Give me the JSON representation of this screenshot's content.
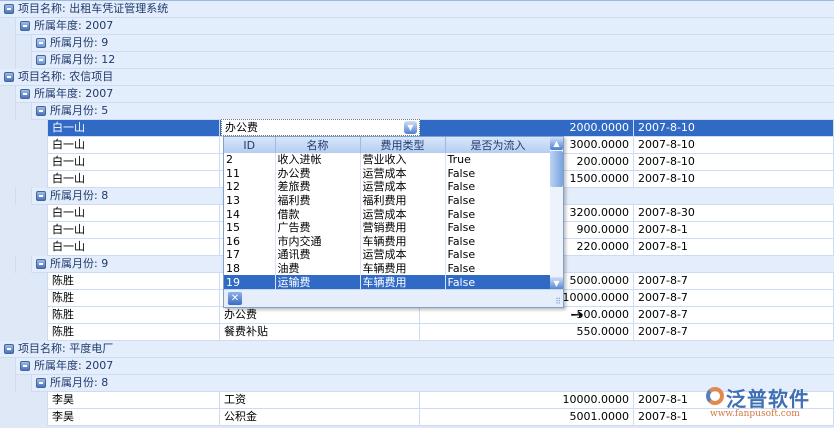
{
  "rows": [
    {
      "type": "group",
      "level": 0,
      "text": "项目名称: 出租车凭证管理系统"
    },
    {
      "type": "group",
      "level": 1,
      "text": "所属年度: 2007"
    },
    {
      "type": "group",
      "level": 2,
      "text": "所属月份: 9",
      "collapsed": true
    },
    {
      "type": "group",
      "level": 2,
      "text": "所属月份: 12",
      "collapsed": true
    },
    {
      "type": "group",
      "level": 0,
      "text": "项目名称: 农信项目"
    },
    {
      "type": "group",
      "level": 1,
      "text": "所属年度: 2007"
    },
    {
      "type": "group",
      "level": 2,
      "text": "所属月份: 5"
    },
    {
      "type": "data",
      "selected": true,
      "cells": [
        "白一山",
        "",
        "2000.0000",
        "2007-8-10"
      ]
    },
    {
      "type": "data",
      "cells": [
        "白一山",
        "",
        "3000.0000",
        "2007-8-10"
      ]
    },
    {
      "type": "data",
      "cells": [
        "白一山",
        "",
        "200.0000",
        "2007-8-10"
      ]
    },
    {
      "type": "data",
      "cells": [
        "白一山",
        "",
        "1500.0000",
        "2007-8-10"
      ]
    },
    {
      "type": "group",
      "level": 2,
      "text": "所属月份: 8"
    },
    {
      "type": "data",
      "cells": [
        "白一山",
        "",
        "3200.0000",
        "2007-8-30"
      ]
    },
    {
      "type": "data",
      "cells": [
        "白一山",
        "",
        "900.0000",
        "2007-8-1"
      ]
    },
    {
      "type": "data",
      "cells": [
        "白一山",
        "",
        "220.0000",
        "2007-8-1"
      ]
    },
    {
      "type": "group",
      "level": 2,
      "text": "所属月份: 9"
    },
    {
      "type": "data",
      "cells": [
        "陈胜",
        "",
        "5000.0000",
        "2007-8-7"
      ]
    },
    {
      "type": "data",
      "cells": [
        "陈胜",
        "",
        "10000.0000",
        "2007-8-7"
      ]
    },
    {
      "type": "data",
      "cells": [
        "陈胜",
        "办公费",
        "500.0000",
        "2007-8-7"
      ]
    },
    {
      "type": "data",
      "cells": [
        "陈胜",
        "餐费补贴",
        "550.0000",
        "2007-8-7"
      ]
    },
    {
      "type": "group",
      "level": 0,
      "text": "项目名称: 平度电厂"
    },
    {
      "type": "group",
      "level": 1,
      "text": "所属年度: 2007"
    },
    {
      "type": "group",
      "level": 2,
      "text": "所属月份: 8"
    },
    {
      "type": "data",
      "cells": [
        "李昊",
        "工资",
        "10000.0000",
        "2007-8-1"
      ]
    },
    {
      "type": "data",
      "cells": [
        "李昊",
        "公积金",
        "5001.0000",
        "2007-8-1"
      ]
    }
  ],
  "combo": {
    "value": "办公费"
  },
  "popup": {
    "headers": [
      "ID",
      "名称",
      "费用类型",
      "是否为流入"
    ],
    "rows": [
      [
        "2",
        "收入进帐",
        "营业收入",
        "True"
      ],
      [
        "11",
        "办公费",
        "运营成本",
        "False"
      ],
      [
        "12",
        "差旅费",
        "运营成本",
        "False"
      ],
      [
        "13",
        "福利费",
        "福利费用",
        "False"
      ],
      [
        "14",
        "借款",
        "运营成本",
        "False"
      ],
      [
        "15",
        "广告费",
        "营销费用",
        "False"
      ],
      [
        "16",
        "市内交通",
        "车辆费用",
        "False"
      ],
      [
        "17",
        "通讯费",
        "运营成本",
        "False"
      ],
      [
        "18",
        "油费",
        "车辆费用",
        "False"
      ],
      [
        "19",
        "运输费",
        "车辆费用",
        "False"
      ]
    ],
    "selected_index": 9
  },
  "logo": {
    "name": "泛普软件",
    "url": "www.fanpusoft.com"
  }
}
